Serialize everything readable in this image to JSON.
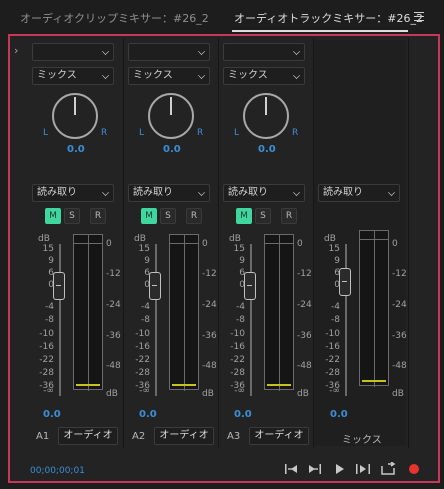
{
  "tabs": {
    "clip_mixer": "オーディオクリップミキサー：#26_2",
    "track_mixer": "オーディオトラックミキサー：#26_2"
  },
  "icons": {
    "menu": "hamburger-icon",
    "expander": "chevron-right-icon"
  },
  "colors": {
    "accent_blue": "#3b8fd6",
    "mute_active": "#3fd6a0",
    "selection_border": "#c8365a",
    "record": "#e8332e",
    "meter_floor": "#c6c21c"
  },
  "fader_scale": [
    "dB",
    "15",
    "9",
    "6",
    "0",
    "-4",
    "-8",
    "-10",
    "-16",
    "-22",
    "-28",
    "-36",
    "-∞"
  ],
  "meter_scale": [
    "0",
    "-12",
    "-24",
    "-36",
    "-48",
    "dB"
  ],
  "tracks": [
    {
      "input_value": "",
      "effect_value": "ミックス",
      "pan_left": "L",
      "pan_right": "R",
      "pan_value": "0.0",
      "automation": "読み取り",
      "mute": "M",
      "solo": "S",
      "record": "R",
      "mute_active": true,
      "volume": "0.0",
      "id": "A1",
      "name": "オーディオ"
    },
    {
      "input_value": "",
      "effect_value": "ミックス",
      "pan_left": "L",
      "pan_right": "R",
      "pan_value": "0.0",
      "automation": "読み取り",
      "mute": "M",
      "solo": "S",
      "record": "R",
      "mute_active": true,
      "volume": "0.0",
      "id": "A2",
      "name": "オーディオ"
    },
    {
      "input_value": "",
      "effect_value": "ミックス",
      "pan_left": "L",
      "pan_right": "R",
      "pan_value": "0.0",
      "automation": "読み取り",
      "mute": "M",
      "solo": "S",
      "record": "R",
      "mute_active": true,
      "volume": "0.0",
      "id": "A3",
      "name": "オーディオ"
    }
  ],
  "master": {
    "automation": "読み取り",
    "volume": "0.0",
    "name": "ミックス"
  },
  "transport": {
    "timecode": "00;00;00;01",
    "buttons": [
      "go-to-in-icon",
      "go-to-out-icon",
      "play-icon",
      "play-in-to-out-icon",
      "loop-icon",
      "record-icon"
    ]
  }
}
